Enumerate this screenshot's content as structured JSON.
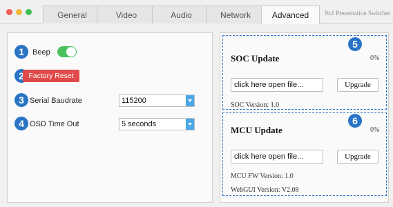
{
  "window": {
    "app_title": "9x1 Presentation Switcher"
  },
  "tabs": [
    {
      "label": "General",
      "active": false
    },
    {
      "label": "Video",
      "active": false
    },
    {
      "label": "Audio",
      "active": false
    },
    {
      "label": "Network",
      "active": false
    },
    {
      "label": "Advanced",
      "active": true
    }
  ],
  "settings": {
    "beep": {
      "badge": "1",
      "label": "Beep",
      "enabled": true
    },
    "factory_reset": {
      "badge": "2",
      "label": "Factory Reset"
    },
    "serial_baudrate": {
      "badge": "3",
      "label": "Serial Baudrate",
      "value": "115200"
    },
    "osd_timeout": {
      "badge": "4",
      "label": "OSD Time Out",
      "value": "5 seconds"
    }
  },
  "soc_update": {
    "badge": "5",
    "title": "SOC Update",
    "progress": "0%",
    "file_input_text": "click here open file...",
    "upgrade_label": "Upgrade",
    "version": "SOC Version:  1.0"
  },
  "mcu_update": {
    "badge": "6",
    "title": "MCU Update",
    "progress": "0%",
    "file_input_text": "click here open file...",
    "upgrade_label": "Upgrade",
    "fw_version": "MCU FW Version:  1.0",
    "webgui_version": "WebGUI Version:  V2.08"
  },
  "colors": {
    "badge": "#2a74c6",
    "toggle_on": "#4cc25e",
    "factory_reset": "#e04a4a",
    "dashed_border": "#2a74c6"
  }
}
